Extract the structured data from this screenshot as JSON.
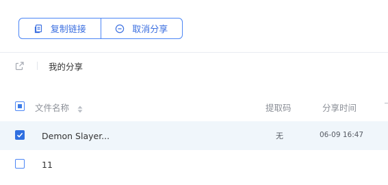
{
  "toolbar": {
    "copy_link_label": "复制链接",
    "cancel_share_label": "取消分享"
  },
  "breadcrumb": {
    "title": "我的分享"
  },
  "table": {
    "columns": {
      "file_name": "文件名称",
      "extract_code": "提取码",
      "share_time": "分享时间"
    },
    "rows": [
      {
        "name": "Demon Slayer...",
        "extract_code": "无",
        "share_time": "06-09 16:47",
        "checked": true
      },
      {
        "name": "11",
        "extract_code": "",
        "share_time": "",
        "checked": false
      }
    ]
  },
  "colors": {
    "accent": "#3b6fe0",
    "row_highlight": "#f0f6fb",
    "header_text": "#8b8f97"
  }
}
